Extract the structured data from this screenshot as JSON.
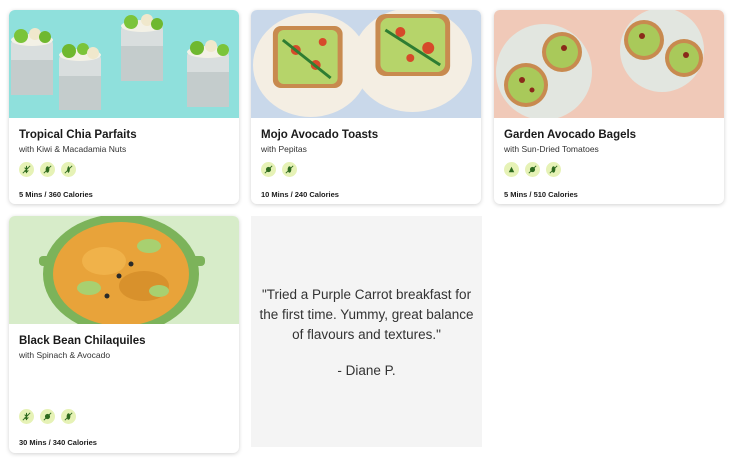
{
  "recipes": [
    {
      "title": "Tropical Chia Parfaits",
      "subtitle": "with Kiwi & Macadamia Nuts",
      "stats": "5 Mins / 360 Calories",
      "badges": [
        "gluten-free-icon",
        "soy-free-icon",
        "oil-free-icon"
      ]
    },
    {
      "title": "Mojo Avocado Toasts",
      "subtitle": "with Pepitas",
      "stats": "10 Mins / 240 Calories",
      "badges": [
        "nut-free-icon",
        "soy-free-icon"
      ]
    },
    {
      "title": "Garden Avocado Bagels",
      "subtitle": "with Sun-Dried Tomatoes",
      "stats": "5 Mins / 510 Calories",
      "badges": [
        "quick-icon",
        "nut-free-icon",
        "soy-free-icon"
      ]
    },
    {
      "title": "Black Bean Chilaquiles",
      "subtitle": "with Spinach & Avocado",
      "stats": "30 Mins / 340 Calories",
      "badges": [
        "gluten-free-icon",
        "nut-free-icon",
        "soy-free-icon"
      ]
    }
  ],
  "testimonial": {
    "quote": "\"Tried a Purple Carrot breakfast for the first time. Yummy, great balance of flavours and textures.\"",
    "author": "- Diane P."
  },
  "colors": {
    "badge_bg": "#e6f2b6",
    "badge_icon": "#2e6b1f",
    "quote_bg": "#f4f4f4"
  }
}
